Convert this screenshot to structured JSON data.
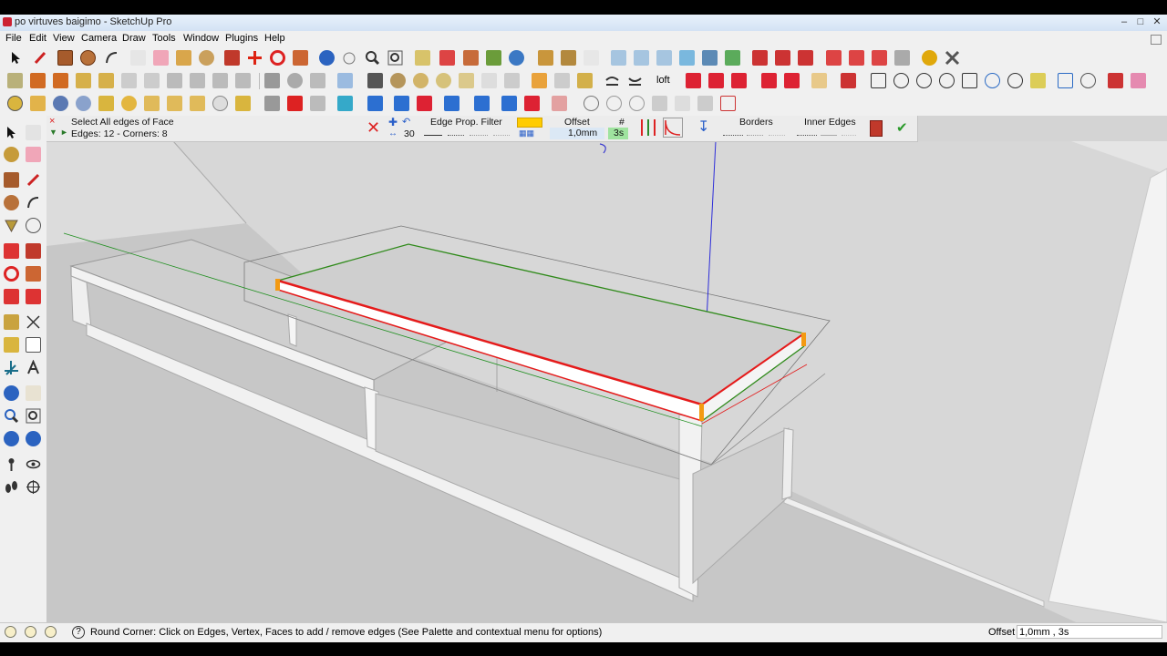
{
  "window": {
    "title": "po virtuves baigimo - SketchUp Pro"
  },
  "menu": [
    "File",
    "Edit",
    "View",
    "Camera",
    "Draw",
    "Tools",
    "Window",
    "Plugins",
    "Help"
  ],
  "round_corner": {
    "mode_label": "Select All edges of Face",
    "edges_summary": "Edges: 12 - Corners: 8",
    "segments_value": "30",
    "filter_label": "Edge Prop. Filter",
    "offset_label": "Offset",
    "offset_value": "1,0mm",
    "hash_label": "#",
    "hash_value": "3s",
    "borders_label": "Borders",
    "inner_edges_label": "Inner Edges"
  },
  "toolbar_text": {
    "loft": "loft"
  },
  "status": {
    "hint": "Round Corner: Click on Edges, Vertex, Faces to add / remove edges (See Palette and contextual menu for options)",
    "vcb_label": "Offset",
    "vcb_value": "1,0mm , 3s"
  },
  "colors": {
    "axis_red": "#e21d1d",
    "axis_green": "#1f8f1f",
    "axis_blue": "#2d2dd8",
    "selection_red": "#e51b1b",
    "selection_green": "#2f8a1a",
    "vertex_orange": "#f39a12",
    "highlight_yellow": "#ffcc00"
  }
}
